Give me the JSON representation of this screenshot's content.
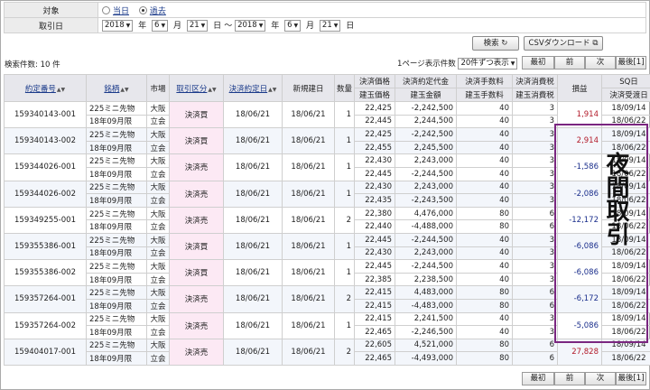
{
  "filter": {
    "target_label": "対象",
    "opt_today": "当日",
    "opt_past": "過去",
    "date_label": "取引日",
    "from": {
      "year": "2018",
      "month": "6",
      "day": "21"
    },
    "to": {
      "year": "2018",
      "month": "6",
      "day": "21"
    },
    "year_unit": "年",
    "month_unit": "月",
    "day_unit": "日",
    "range_sep": "～"
  },
  "search_label": "検索",
  "csv_label": "CSVダウンロード",
  "result_count": "検索件数: 10 件",
  "perpage_label": "1ページ表示件数",
  "perpage_value": "20件ずつ表示",
  "pager": {
    "first": "最初",
    "prev": "前",
    "next": "次",
    "last": "最後[1]"
  },
  "headers": {
    "contract_no": "約定番号",
    "symbol": "銘柄",
    "market": "市場",
    "trade_type": "取引区分",
    "settle_date": "決済約定日",
    "open_date": "新規建日",
    "qty": "数量",
    "settle_price": "決済価格",
    "open_price": "建玉価格",
    "settle_amount": "決済約定代金",
    "open_amount": "建玉金額",
    "settle_fee": "決済手数料",
    "open_fee": "建玉手数料",
    "settle_tax": "決済消費税",
    "open_tax": "建玉消費税",
    "pnl": "損益",
    "sq": "SQ日",
    "delivery": "決済受渡日"
  },
  "rows": [
    {
      "no": "159340143-001",
      "sym1": "225ミニ先物",
      "sym2": "18年09月限",
      "mk1": "大阪",
      "mk2": "立会",
      "type": "決済買",
      "sdate": "18/06/21",
      "odate": "18/06/21",
      "qty": "1",
      "sp": "22,425",
      "op": "22,445",
      "sa": "-2,242,500",
      "oa": "2,244,500",
      "sf": "40",
      "of": "40",
      "st": "3",
      "ot": "3",
      "pnl": "1,914",
      "pnl_sign": "pos",
      "sq": "18/09/14",
      "dl": "18/06/22"
    },
    {
      "no": "159340143-002",
      "sym1": "225ミニ先物",
      "sym2": "18年09月限",
      "mk1": "大阪",
      "mk2": "立会",
      "type": "決済買",
      "sdate": "18/06/21",
      "odate": "18/06/21",
      "qty": "1",
      "sp": "22,425",
      "op": "22,455",
      "sa": "-2,242,500",
      "oa": "2,245,500",
      "sf": "40",
      "of": "40",
      "st": "3",
      "ot": "3",
      "pnl": "2,914",
      "pnl_sign": "pos",
      "sq": "18/09/14",
      "dl": "18/06/22"
    },
    {
      "no": "159344026-001",
      "sym1": "225ミニ先物",
      "sym2": "18年09月限",
      "mk1": "大阪",
      "mk2": "立会",
      "type": "決済売",
      "sdate": "18/06/21",
      "odate": "18/06/21",
      "qty": "1",
      "sp": "22,430",
      "op": "22,445",
      "sa": "2,243,000",
      "oa": "-2,244,500",
      "sf": "40",
      "of": "40",
      "st": "3",
      "ot": "3",
      "pnl": "-1,586",
      "pnl_sign": "neg",
      "sq": "18/09/14",
      "dl": "18/06/22"
    },
    {
      "no": "159344026-002",
      "sym1": "225ミニ先物",
      "sym2": "18年09月限",
      "mk1": "大阪",
      "mk2": "立会",
      "type": "決済売",
      "sdate": "18/06/21",
      "odate": "18/06/21",
      "qty": "1",
      "sp": "22,430",
      "op": "22,435",
      "sa": "2,243,000",
      "oa": "-2,243,500",
      "sf": "40",
      "of": "40",
      "st": "3",
      "ot": "3",
      "pnl": "-2,086",
      "pnl_sign": "neg",
      "sq": "18/09/14",
      "dl": "18/06/22"
    },
    {
      "no": "159349255-001",
      "sym1": "225ミニ先物",
      "sym2": "18年09月限",
      "mk1": "大阪",
      "mk2": "立会",
      "type": "決済売",
      "sdate": "18/06/21",
      "odate": "18/06/21",
      "qty": "2",
      "sp": "22,380",
      "op": "22,440",
      "sa": "4,476,000",
      "oa": "-4,488,000",
      "sf": "80",
      "of": "80",
      "st": "6",
      "ot": "6",
      "pnl": "-12,172",
      "pnl_sign": "neg",
      "sq": "18/09/14",
      "dl": "18/06/22"
    },
    {
      "no": "159355386-001",
      "sym1": "225ミニ先物",
      "sym2": "18年09月限",
      "mk1": "大阪",
      "mk2": "立会",
      "type": "決済買",
      "sdate": "18/06/21",
      "odate": "18/06/21",
      "qty": "1",
      "sp": "22,445",
      "op": "22,430",
      "sa": "-2,244,500",
      "oa": "2,243,000",
      "sf": "40",
      "of": "40",
      "st": "3",
      "ot": "3",
      "pnl": "-6,086",
      "pnl_sign": "neg",
      "sq": "18/09/14",
      "dl": "18/06/22"
    },
    {
      "no": "159355386-002",
      "sym1": "225ミニ先物",
      "sym2": "18年09月限",
      "mk1": "大阪",
      "mk2": "立会",
      "type": "決済買",
      "sdate": "18/06/21",
      "odate": "18/06/21",
      "qty": "1",
      "sp": "22,445",
      "op": "22,385",
      "sa": "-2,244,500",
      "oa": "2,238,500",
      "sf": "40",
      "of": "40",
      "st": "3",
      "ot": "3",
      "pnl": "-6,086",
      "pnl_sign": "neg",
      "sq": "18/09/14",
      "dl": "18/06/22"
    },
    {
      "no": "159357264-001",
      "sym1": "225ミニ先物",
      "sym2": "18年09月限",
      "mk1": "大阪",
      "mk2": "立会",
      "type": "決済売",
      "sdate": "18/06/21",
      "odate": "18/06/21",
      "qty": "2",
      "sp": "22,415",
      "op": "22,415",
      "sa": "4,483,000",
      "oa": "-4,483,000",
      "sf": "80",
      "of": "80",
      "st": "6",
      "ot": "6",
      "pnl": "-6,172",
      "pnl_sign": "neg",
      "sq": "18/09/14",
      "dl": "18/06/22"
    },
    {
      "no": "159357264-002",
      "sym1": "225ミニ先物",
      "sym2": "18年09月限",
      "mk1": "大阪",
      "mk2": "立会",
      "type": "決済売",
      "sdate": "18/06/21",
      "odate": "18/06/21",
      "qty": "1",
      "sp": "22,415",
      "op": "22,465",
      "sa": "2,241,500",
      "oa": "-2,246,500",
      "sf": "40",
      "of": "40",
      "st": "3",
      "ot": "3",
      "pnl": "-5,086",
      "pnl_sign": "neg",
      "sq": "18/09/14",
      "dl": "18/06/22"
    },
    {
      "no": "159404017-001",
      "sym1": "225ミニ先物",
      "sym2": "18年09月限",
      "mk1": "大阪",
      "mk2": "立会",
      "type": "決済売",
      "sdate": "18/06/21",
      "odate": "18/06/21",
      "qty": "2",
      "sp": "22,605",
      "op": "22,465",
      "sa": "4,521,000",
      "oa": "-4,493,000",
      "sf": "80",
      "of": "80",
      "st": "6",
      "ot": "6",
      "pnl": "27,828",
      "pnl_sign": "pos",
      "sq": "18/09/14",
      "dl": "18/06/22"
    }
  ],
  "annotation": "夜間取引",
  "colors": {
    "annotation_border": "#7a2680",
    "positive": "#b21b2a",
    "negative": "#1b2f8c",
    "trade_cell": "#fce9f4"
  }
}
